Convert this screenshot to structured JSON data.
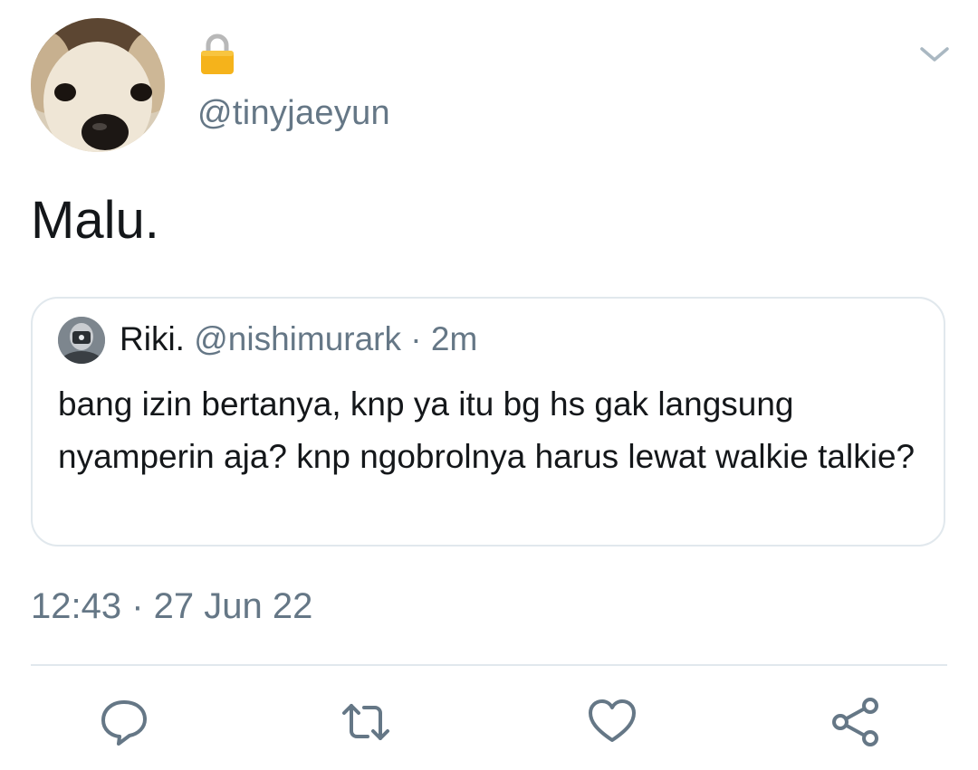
{
  "tweet": {
    "handle": "@tinyjaeyun",
    "protected_icon": "lock-icon",
    "menu_icon": "chevron-down-icon",
    "text": "Malu.",
    "timestamp": "12:43 · 27 Jun 22"
  },
  "quoted_tweet": {
    "name": "Riki.",
    "meta": " @nishimurark · 2m",
    "text": "bang izin bertanya, knp ya itu bg hs gak langsung nyamperin aja? knp ngobrolnya harus lewat walkie talkie?"
  },
  "actions": {
    "icons": [
      "reply-icon",
      "retweet-icon",
      "like-icon",
      "share-icon"
    ],
    "icon_color": "#657786"
  },
  "colors": {
    "primary_text": "#14171a",
    "secondary_text": "#657786",
    "border": "#e1e8ed",
    "lock": "#f5b31b"
  }
}
